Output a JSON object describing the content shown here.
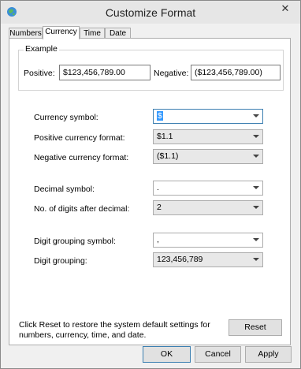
{
  "window": {
    "title": "Customize Format",
    "close_label": "✕"
  },
  "tabs": [
    {
      "label": "Numbers",
      "active": false
    },
    {
      "label": "Currency",
      "active": true
    },
    {
      "label": "Time",
      "active": false
    },
    {
      "label": "Date",
      "active": false
    }
  ],
  "example": {
    "group_title": "Example",
    "positive_label": "Positive:",
    "positive_value": "$123,456,789.00",
    "negative_label": "Negative:",
    "negative_value": "($123,456,789.00)"
  },
  "fields": {
    "currency_symbol": {
      "label": "Currency symbol:",
      "value": "$"
    },
    "positive_format": {
      "label": "Positive currency format:",
      "value": "$1.1"
    },
    "negative_format": {
      "label": "Negative currency format:",
      "value": "($1.1)"
    },
    "decimal_symbol": {
      "label": "Decimal symbol:",
      "value": "."
    },
    "digits_after_decimal": {
      "label": "No. of digits after decimal:",
      "value": "2"
    },
    "digit_grouping_symbol": {
      "label": "Digit grouping symbol:",
      "value": ","
    },
    "digit_grouping": {
      "label": "Digit grouping:",
      "value": "123,456,789"
    }
  },
  "reset": {
    "text_line1": "Click Reset to restore the system default settings for",
    "text_line2": "numbers, currency, time, and date.",
    "button_label": "Reset"
  },
  "buttons": {
    "ok": "OK",
    "cancel": "Cancel",
    "apply": "Apply"
  },
  "colors": {
    "accent": "#3c7fb1",
    "selection": "#3399ff"
  }
}
